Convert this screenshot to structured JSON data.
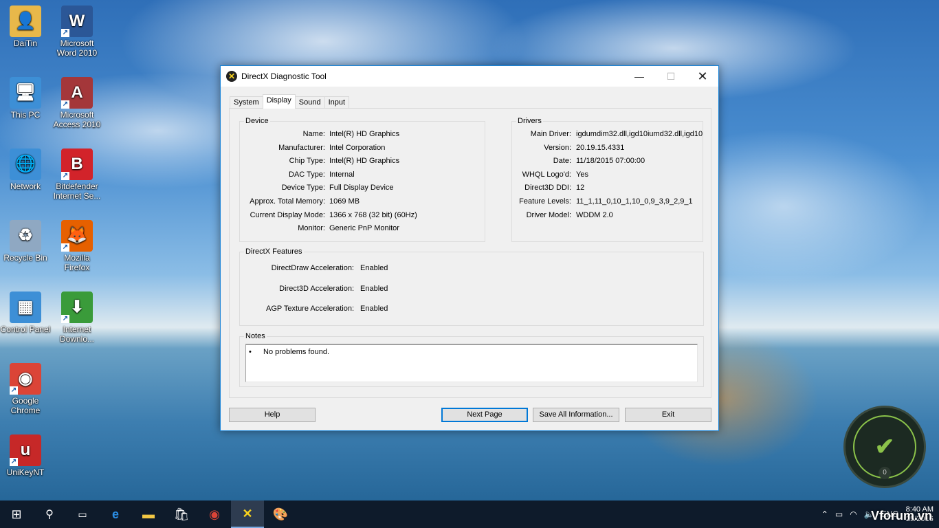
{
  "desktop": {
    "icons": [
      {
        "label": "DaiTin",
        "glyph": "👤",
        "color": "#e8b84a",
        "icon": "user-folder-icon"
      },
      {
        "label": "Microsoft Word 2010",
        "glyph": "W",
        "color": "#2b5797",
        "icon": "word-icon"
      },
      {
        "label": "This PC",
        "glyph": "🖥",
        "color": "#3d8fd6",
        "icon": "computer-icon"
      },
      {
        "label": "Microsoft Access 2010",
        "glyph": "A",
        "color": "#a4373a",
        "icon": "access-icon"
      },
      {
        "label": "Network",
        "glyph": "🌐",
        "color": "#3d8fd6",
        "icon": "network-icon"
      },
      {
        "label": "Bitdefender Internet Se...",
        "glyph": "B",
        "color": "#d2232a",
        "icon": "bitdefender-icon"
      },
      {
        "label": "Recycle Bin",
        "glyph": "♻",
        "color": "#8fa8c2",
        "icon": "recycle-bin-icon"
      },
      {
        "label": "Mozilla Firefox",
        "glyph": "🦊",
        "color": "#e66000",
        "icon": "firefox-icon"
      },
      {
        "label": "Control Panel",
        "glyph": "▦",
        "color": "#3d8fd6",
        "icon": "control-panel-icon"
      },
      {
        "label": "Internet Downlo...",
        "glyph": "⬇",
        "color": "#3a9b3a",
        "icon": "internet-download-manager-icon"
      },
      {
        "label": "Google Chrome",
        "glyph": "◉",
        "color": "#db4437",
        "icon": "chrome-icon"
      },
      {
        "label": "UniKeyNT",
        "glyph": "u",
        "color": "#c62828",
        "icon": "unikey-icon"
      }
    ]
  },
  "window": {
    "title": "DirectX Diagnostic Tool",
    "close_glyph": "✕",
    "minimize_glyph": "—",
    "maximize_glyph": "☐",
    "tabs": [
      "System",
      "Display",
      "Sound",
      "Input"
    ],
    "active_tab": "Display",
    "device": {
      "legend": "Device",
      "rows": [
        {
          "label": "Name:",
          "value": "Intel(R) HD Graphics"
        },
        {
          "label": "Manufacturer:",
          "value": "Intel Corporation"
        },
        {
          "label": "Chip Type:",
          "value": "Intel(R) HD Graphics"
        },
        {
          "label": "DAC Type:",
          "value": "Internal"
        },
        {
          "label": "Device Type:",
          "value": "Full Display Device"
        },
        {
          "label": "Approx. Total Memory:",
          "value": "1069 MB"
        },
        {
          "label": "Current Display Mode:",
          "value": "1366 x 768 (32 bit) (60Hz)"
        },
        {
          "label": "Monitor:",
          "value": "Generic PnP Monitor"
        }
      ]
    },
    "drivers": {
      "legend": "Drivers",
      "rows": [
        {
          "label": "Main Driver:",
          "value": "igdumdim32.dll,igd10iumd32.dll,igd10"
        },
        {
          "label": "Version:",
          "value": "20.19.15.4331"
        },
        {
          "label": "Date:",
          "value": "11/18/2015 07:00:00"
        },
        {
          "label": "WHQL Logo'd:",
          "value": "Yes"
        },
        {
          "label": "Direct3D DDI:",
          "value": "12"
        },
        {
          "label": "Feature Levels:",
          "value": "11_1,11_0,10_1,10_0,9_3,9_2,9_1"
        },
        {
          "label": "Driver Model:",
          "value": "WDDM 2.0"
        }
      ]
    },
    "features": {
      "legend": "DirectX Features",
      "rows": [
        {
          "label": "DirectDraw Acceleration:",
          "value": "Enabled"
        },
        {
          "label": "Direct3D Acceleration:",
          "value": "Enabled"
        },
        {
          "label": "AGP Texture Acceleration:",
          "value": "Enabled"
        }
      ]
    },
    "notes": {
      "legend": "Notes",
      "bullet": "•",
      "text": "No problems found."
    },
    "buttons": {
      "help": "Help",
      "next": "Next Page",
      "save": "Save All Information...",
      "exit": "Exit"
    }
  },
  "taskbar": {
    "language": "ENG",
    "time": "8:40 AM",
    "date": "25/2016",
    "watermark": "Vforum.vn"
  },
  "widget": {
    "count": "0"
  }
}
